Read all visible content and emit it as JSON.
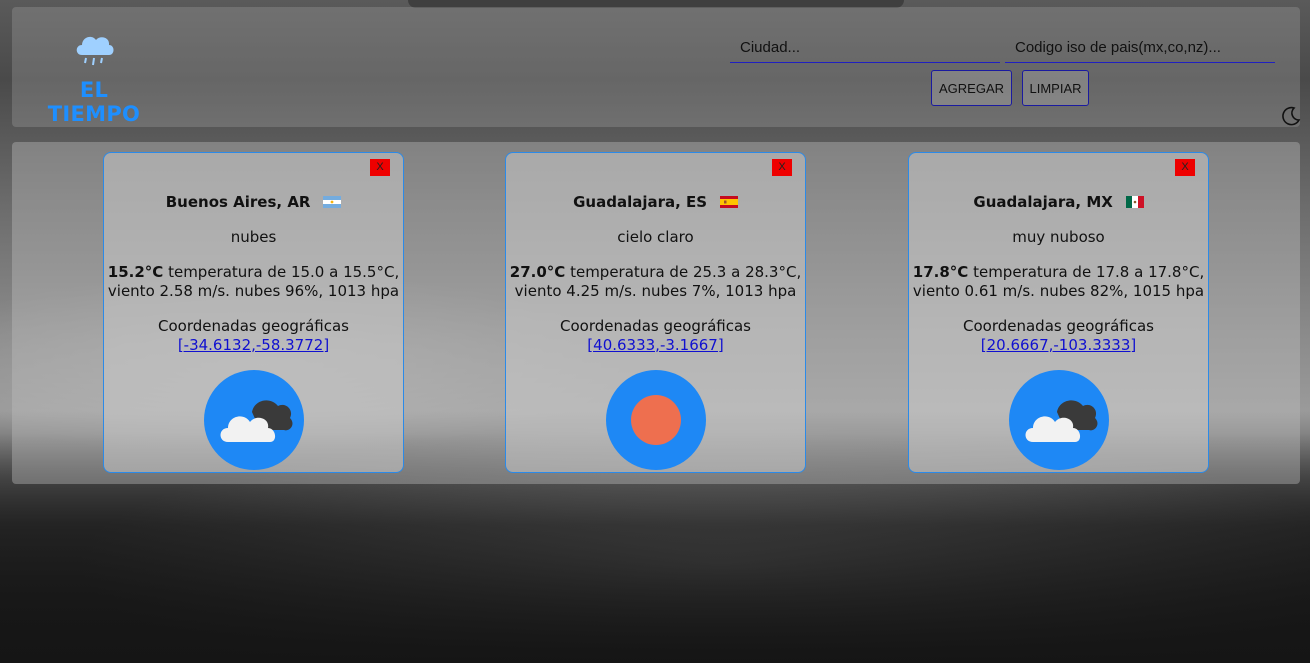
{
  "header": {
    "logo_title": "EL TIEMPO",
    "city_placeholder": "Ciudad...",
    "country_placeholder": "Codigo iso de pais(mx,co,nz)...",
    "add_label": "AGREGAR",
    "clear_label": "LIMPIAR"
  },
  "cards": [
    {
      "close_label": "X",
      "city": "Buenos Aires, AR",
      "flag": "argentina-flag-icon",
      "description": "nubes",
      "temp": "15.2°C",
      "detail_line1": " temperatura de 15.0 a 15.5°C,",
      "detail_line2": "viento 2.58 m/s. nubes 96%, 1013 hpa",
      "coords_label": "Coordenadas geográficas",
      "coords": "[-34.6132,-58.3772]",
      "weather_icon": "cloud-icon"
    },
    {
      "close_label": "X",
      "city": "Guadalajara, ES",
      "flag": "spain-flag-icon",
      "description": "cielo claro",
      "temp": "27.0°C",
      "detail_line1": " temperatura de 25.3 a 28.3°C,",
      "detail_line2": "viento 4.25 m/s. nubes 7%, 1013 hpa",
      "coords_label": "Coordenadas geográficas",
      "coords": "[40.6333,-3.1667]",
      "weather_icon": "sun-icon"
    },
    {
      "close_label": "X",
      "city": "Guadalajara, MX",
      "flag": "mexico-flag-icon",
      "description": "muy nuboso",
      "temp": "17.8°C",
      "detail_line1": " temperatura de 17.8 a 17.8°C,",
      "detail_line2": "viento 0.61 m/s. nubes 82%, 1015 hpa",
      "coords_label": "Coordenadas geográficas",
      "coords": "[20.6667,-103.3333]",
      "weather_icon": "cloud-icon"
    }
  ],
  "colors": {
    "accent": "#1e8fff",
    "weather_circle": "#1e88f5",
    "sun": "#ee6f4f",
    "close": "#ee0000",
    "link": "#1010d0",
    "card_border": "#2b8ae8"
  }
}
